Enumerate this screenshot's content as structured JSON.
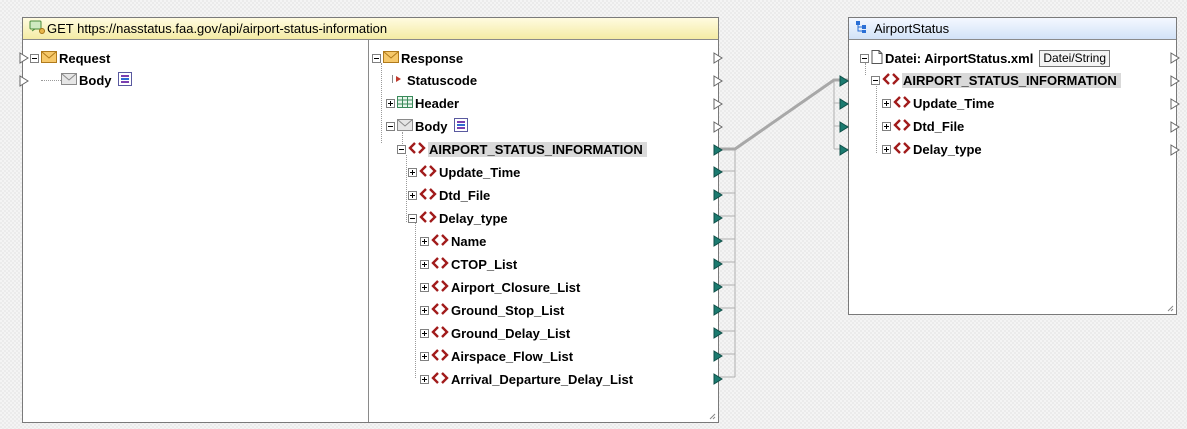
{
  "source": {
    "title": "GET https://nasstatus.faa.gov/api/airport-status-information",
    "request": {
      "label": "Request",
      "body_label": "Body"
    },
    "response": {
      "label": "Response",
      "statuscode": "Statuscode",
      "header": "Header",
      "body_label": "Body",
      "root": "AIRPORT_STATUS_INFORMATION",
      "update_time": "Update_Time",
      "dtd_file": "Dtd_File",
      "delay_type": "Delay_type",
      "delay_children": [
        "Name",
        "CTOP_List",
        "Airport_Closure_List",
        "Ground_Stop_List",
        "Ground_Delay_List",
        "Airspace_Flow_List",
        "Arrival_Departure_Delay_List"
      ]
    }
  },
  "target": {
    "title": "AirportStatus",
    "file_label": "Datei: AirportStatus.xml",
    "file_button": "Datei/String",
    "root": "AIRPORT_STATUS_INFORMATION",
    "children": [
      "Update_Time",
      "Dtd_File",
      "Delay_type"
    ]
  },
  "colors": {
    "element_icon": "#a11b1b",
    "connected_pin": "#1b7a6f",
    "connector_line": "#a8a8a8",
    "service_title": "#f4eba4",
    "target_title": "#d2e2f7"
  }
}
